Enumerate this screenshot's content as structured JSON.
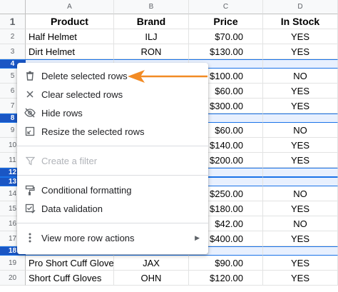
{
  "columns": [
    "A",
    "B",
    "C",
    "D"
  ],
  "rows": [
    {
      "num": "1",
      "cells": [
        "Product",
        "Brand",
        "Price",
        "In Stock"
      ],
      "kind": "header"
    },
    {
      "num": "2",
      "cells": [
        "Half Helmet",
        "ILJ",
        "$70.00",
        "YES"
      ]
    },
    {
      "num": "3",
      "cells": [
        "Dirt Helmet",
        "RON",
        "$130.00",
        "YES"
      ]
    },
    {
      "num": "4",
      "cells": [
        "",
        "",
        "",
        ""
      ],
      "kind": "selected"
    },
    {
      "num": "5",
      "cells": [
        "",
        "",
        "$100.00",
        "NO"
      ]
    },
    {
      "num": "6",
      "cells": [
        "",
        "",
        "$60.00",
        "YES"
      ]
    },
    {
      "num": "7",
      "cells": [
        "",
        "",
        "$300.00",
        "YES"
      ]
    },
    {
      "num": "8",
      "cells": [
        "",
        "",
        "",
        ""
      ],
      "kind": "selected"
    },
    {
      "num": "9",
      "cells": [
        "",
        "",
        "$60.00",
        "NO"
      ]
    },
    {
      "num": "10",
      "cells": [
        "",
        "",
        "$140.00",
        "YES"
      ]
    },
    {
      "num": "11",
      "cells": [
        "",
        "",
        "$200.00",
        "YES"
      ]
    },
    {
      "num": "12",
      "cells": [
        "",
        "",
        "",
        ""
      ],
      "kind": "selected"
    },
    {
      "num": "13",
      "cells": [
        "",
        "",
        "",
        ""
      ],
      "kind": "selected"
    },
    {
      "num": "14",
      "cells": [
        "",
        "",
        "$250.00",
        "NO"
      ]
    },
    {
      "num": "15",
      "cells": [
        "",
        "",
        "$180.00",
        "YES"
      ]
    },
    {
      "num": "16",
      "cells": [
        "",
        "",
        "$42.00",
        "NO"
      ]
    },
    {
      "num": "17",
      "cells": [
        "",
        "",
        "$400.00",
        "YES"
      ]
    },
    {
      "num": "18",
      "cells": [
        "",
        "",
        "",
        ""
      ],
      "kind": "selected"
    },
    {
      "num": "19",
      "cells": [
        "Pro Short Cuff Gloves",
        "JAX",
        "$90.00",
        "YES"
      ]
    },
    {
      "num": "20",
      "cells": [
        "Short Cuff Gloves",
        "OHN",
        "$120.00",
        "YES"
      ]
    }
  ],
  "menu": {
    "delete_rows": "Delete selected rows",
    "clear_rows": "Clear selected rows",
    "hide_rows": "Hide rows",
    "resize_rows": "Resize the selected rows",
    "create_filter": "Create a filter",
    "conditional_formatting": "Conditional formatting",
    "data_validation": "Data validation",
    "more_actions": "View more row actions"
  },
  "colors": {
    "selection_header": "#1a56c4",
    "selection_fill": "#e8f0fe",
    "annotation_arrow": "#f28b24"
  }
}
